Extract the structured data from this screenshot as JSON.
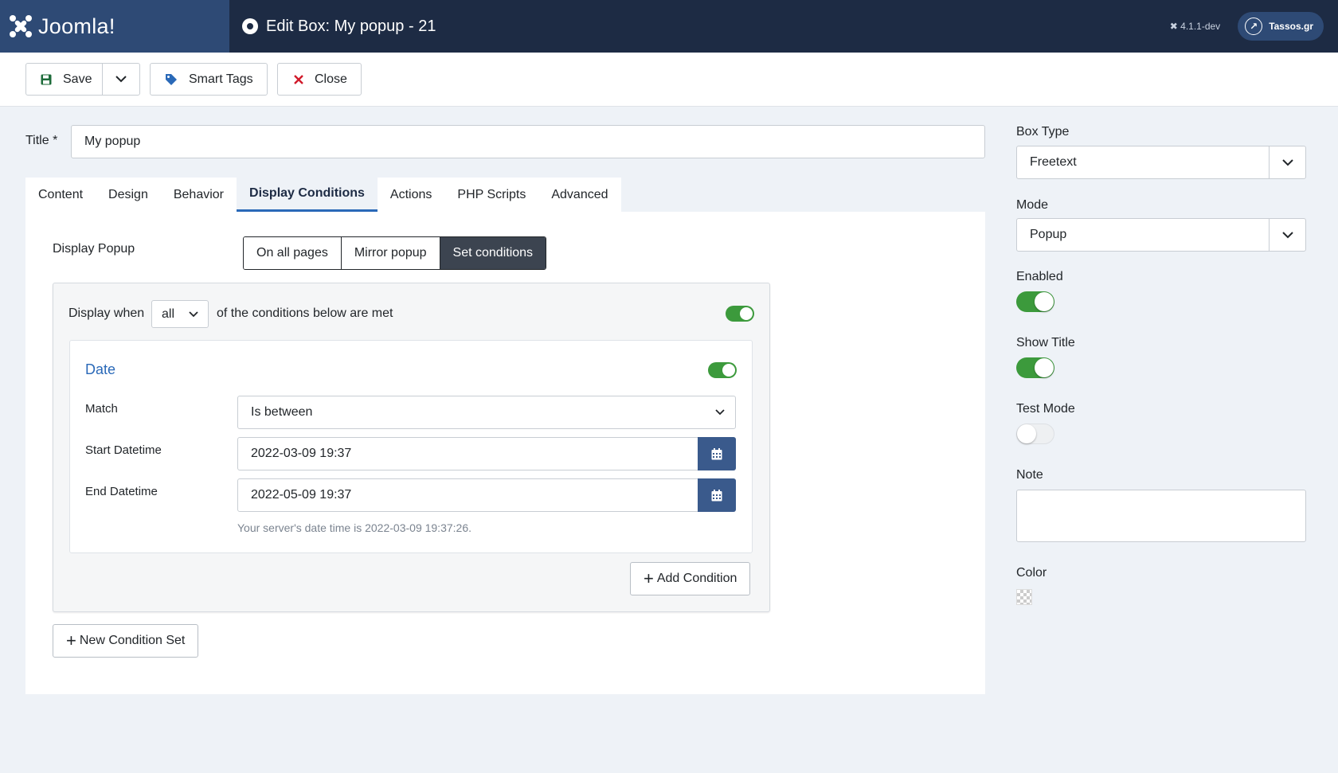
{
  "header": {
    "logo_text": "Joomla!",
    "page_title": "Edit Box: My popup - 21",
    "version": "4.1.1-dev",
    "user_label": "Tassos.gr"
  },
  "toolbar": {
    "save_label": "Save",
    "smart_tags_label": "Smart Tags",
    "close_label": "Close"
  },
  "form": {
    "title_label": "Title *",
    "title_value": "My popup"
  },
  "tabs": [
    {
      "label": "Content",
      "active": false
    },
    {
      "label": "Design",
      "active": false
    },
    {
      "label": "Behavior",
      "active": false
    },
    {
      "label": "Display Conditions",
      "active": true
    },
    {
      "label": "Actions",
      "active": false
    },
    {
      "label": "PHP Scripts",
      "active": false
    },
    {
      "label": "Advanced",
      "active": false
    }
  ],
  "display": {
    "label": "Display Popup",
    "options": [
      "On all pages",
      "Mirror popup",
      "Set conditions"
    ],
    "selected": "Set conditions"
  },
  "condition_set": {
    "display_when_label": "Display when",
    "match_mode": "all",
    "after_label": "of the conditions below are met",
    "enabled": true,
    "condition": {
      "title": "Date",
      "enabled": true,
      "match_label": "Match",
      "match_value": "Is between",
      "start_label": "Start Datetime",
      "start_value": "2022-03-09 19:37",
      "end_label": "End Datetime",
      "end_value": "2022-05-09 19:37",
      "hint": "Your server's date time is 2022-03-09 19:37:26."
    },
    "add_condition_label": "Add Condition"
  },
  "new_condition_set_label": "New Condition Set",
  "sidebar": {
    "box_type_label": "Box Type",
    "box_type_value": "Freetext",
    "mode_label": "Mode",
    "mode_value": "Popup",
    "enabled_label": "Enabled",
    "enabled": true,
    "show_title_label": "Show Title",
    "show_title": true,
    "test_mode_label": "Test Mode",
    "test_mode": false,
    "note_label": "Note",
    "note_value": "",
    "color_label": "Color"
  },
  "colors": {
    "header_bg": "#1d2b44",
    "accent": "#2a69b8",
    "toggle_on": "#3c9a3c",
    "calendar_btn": "#3a5a8c",
    "close_icon": "#d11a2a"
  }
}
